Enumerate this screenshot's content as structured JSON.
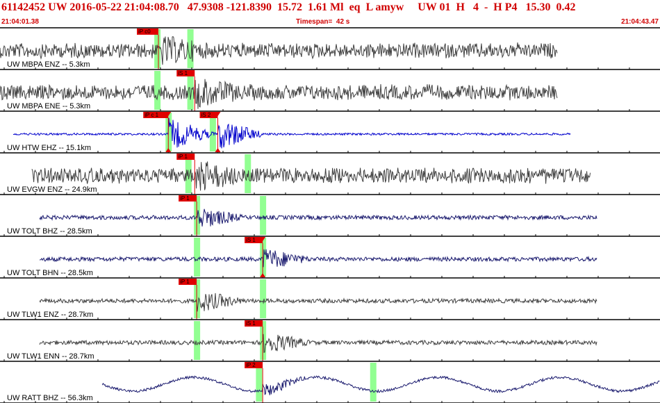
{
  "header": {
    "title": "61142452 UW 2016-05-22 21:04:08.70   47.9308 -121.8390  15.72  1.61 Ml  eq  L amyw     UW 01  H   4  -  H P4   15.30  0.42",
    "start_time": "21:04:01.38",
    "timespan": "Timespan=  42 s",
    "end_time": "21:04:43.47"
  },
  "colors": {
    "header_text": "#d00000",
    "trace_default": "#404040",
    "trace_selected": "#0000cc",
    "trace_navy": "#1a1a6e",
    "pick": "#e00000",
    "phase_window": "#7fff7f"
  },
  "panes": [
    {
      "label": "UW MBPA ENZ -- 5.3km",
      "trace_color": "#404040",
      "trace_start": 0.0,
      "trace_end": 0.845,
      "picks": [
        {
          "label": "iP c0",
          "t": 0.24
        }
      ],
      "windows": [
        0.238,
        0.288
      ]
    },
    {
      "label": "UW MBPA ENE -- 5.3km",
      "trace_color": "#404040",
      "trace_start": 0.0,
      "trace_end": 0.845,
      "picks": [
        {
          "label": "iS 1",
          "t": 0.295
        }
      ],
      "windows": [
        0.238,
        0.288
      ]
    },
    {
      "label": "UW HTW EHZ -- 15.1km",
      "trace_color": "#0000cc",
      "trace_start": 0.02,
      "trace_end": 0.865,
      "picks": [
        {
          "label": "iP c 1",
          "t": 0.255
        },
        {
          "label": "iS 2",
          "t": 0.33
        }
      ],
      "windows": [
        0.255,
        0.322
      ]
    },
    {
      "label": "UW EVGW ENZ -- 24.9km",
      "trace_color": "#404040",
      "trace_start": 0.048,
      "trace_end": 0.895,
      "picks": [
        {
          "label": "iP 1",
          "t": 0.295
        }
      ],
      "windows": [
        0.285,
        0.375
      ]
    },
    {
      "label": "UW TOLT BHZ -- 28.5km",
      "trace_color": "#1a1a6e",
      "trace_start": 0.06,
      "trace_end": 0.905,
      "picks": [
        {
          "label": "iP 1",
          "t": 0.298
        }
      ],
      "windows": [
        0.298,
        0.398
      ]
    },
    {
      "label": "UW TOLT BHN -- 28.5km",
      "trace_color": "#1a1a6e",
      "trace_start": 0.06,
      "trace_end": 0.905,
      "picks": [
        {
          "label": "iS 1",
          "t": 0.398
        }
      ],
      "windows": [
        0.298,
        0.398
      ]
    },
    {
      "label": "UW TLW1 ENZ -- 28.7km",
      "trace_color": "#404040",
      "trace_start": 0.06,
      "trace_end": 0.905,
      "picks": [
        {
          "label": "iP 1",
          "t": 0.298
        }
      ],
      "windows": [
        0.298,
        0.398
      ]
    },
    {
      "label": "UW TLW1 ENN -- 28.7km",
      "trace_color": "#404040",
      "trace_start": 0.06,
      "trace_end": 0.905,
      "picks": [
        {
          "label": "iS 1",
          "t": 0.398
        }
      ],
      "windows": [
        0.298,
        0.398
      ]
    },
    {
      "label": "UW RATT BHZ -- 56.3km",
      "trace_color": "#1a1a6e",
      "trace_start": 0.155,
      "trace_end": 1.0,
      "picks": [
        {
          "label": "iP 2",
          "t": 0.398
        }
      ],
      "windows": [
        0.392,
        0.565
      ]
    }
  ]
}
